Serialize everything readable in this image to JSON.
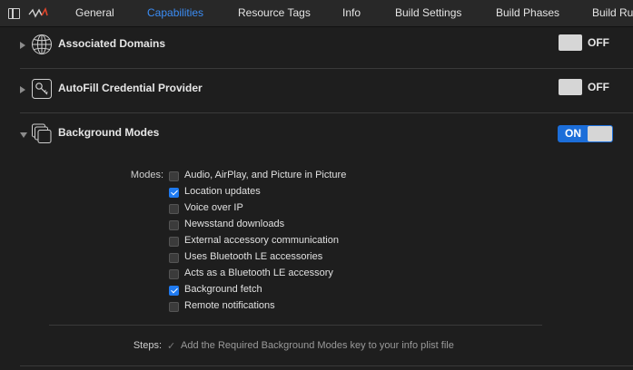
{
  "tabs": [
    {
      "label": "General",
      "active": false
    },
    {
      "label": "Capabilities",
      "active": true
    },
    {
      "label": "Resource Tags",
      "active": false
    },
    {
      "label": "Info",
      "active": false
    },
    {
      "label": "Build Settings",
      "active": false
    },
    {
      "label": "Build Phases",
      "active": false
    },
    {
      "label": "Build Ru",
      "active": false
    }
  ],
  "icons": {
    "sidebar_toggle": "sidebar-toggle-icon",
    "scheme": "scheme-icon",
    "associated_domains": "globe-icon",
    "autofill": "key-icon",
    "background_modes": "stacked-windows-icon"
  },
  "capabilities": {
    "associated_domains": {
      "title": "Associated Domains",
      "state": "OFF"
    },
    "autofill": {
      "title": "AutoFill Credential Provider",
      "state": "OFF"
    },
    "background_modes": {
      "title": "Background Modes",
      "state": "ON",
      "modes_label": "Modes:",
      "modes": [
        {
          "label": "Audio, AirPlay, and Picture in Picture",
          "checked": false
        },
        {
          "label": "Location updates",
          "checked": true
        },
        {
          "label": "Voice over IP",
          "checked": false
        },
        {
          "label": "Newsstand downloads",
          "checked": false
        },
        {
          "label": "External accessory communication",
          "checked": false
        },
        {
          "label": "Uses Bluetooth LE accessories",
          "checked": false
        },
        {
          "label": "Acts as a Bluetooth LE accessory",
          "checked": false
        },
        {
          "label": "Background fetch",
          "checked": true
        },
        {
          "label": "Remote notifications",
          "checked": false
        }
      ],
      "steps_label": "Steps:",
      "steps": [
        "Add the Required Background Modes key to your info plist file"
      ]
    }
  },
  "colors": {
    "accent": "#1c6ed9",
    "active_tab": "#3b8df5",
    "background": "#1e1e1e"
  }
}
